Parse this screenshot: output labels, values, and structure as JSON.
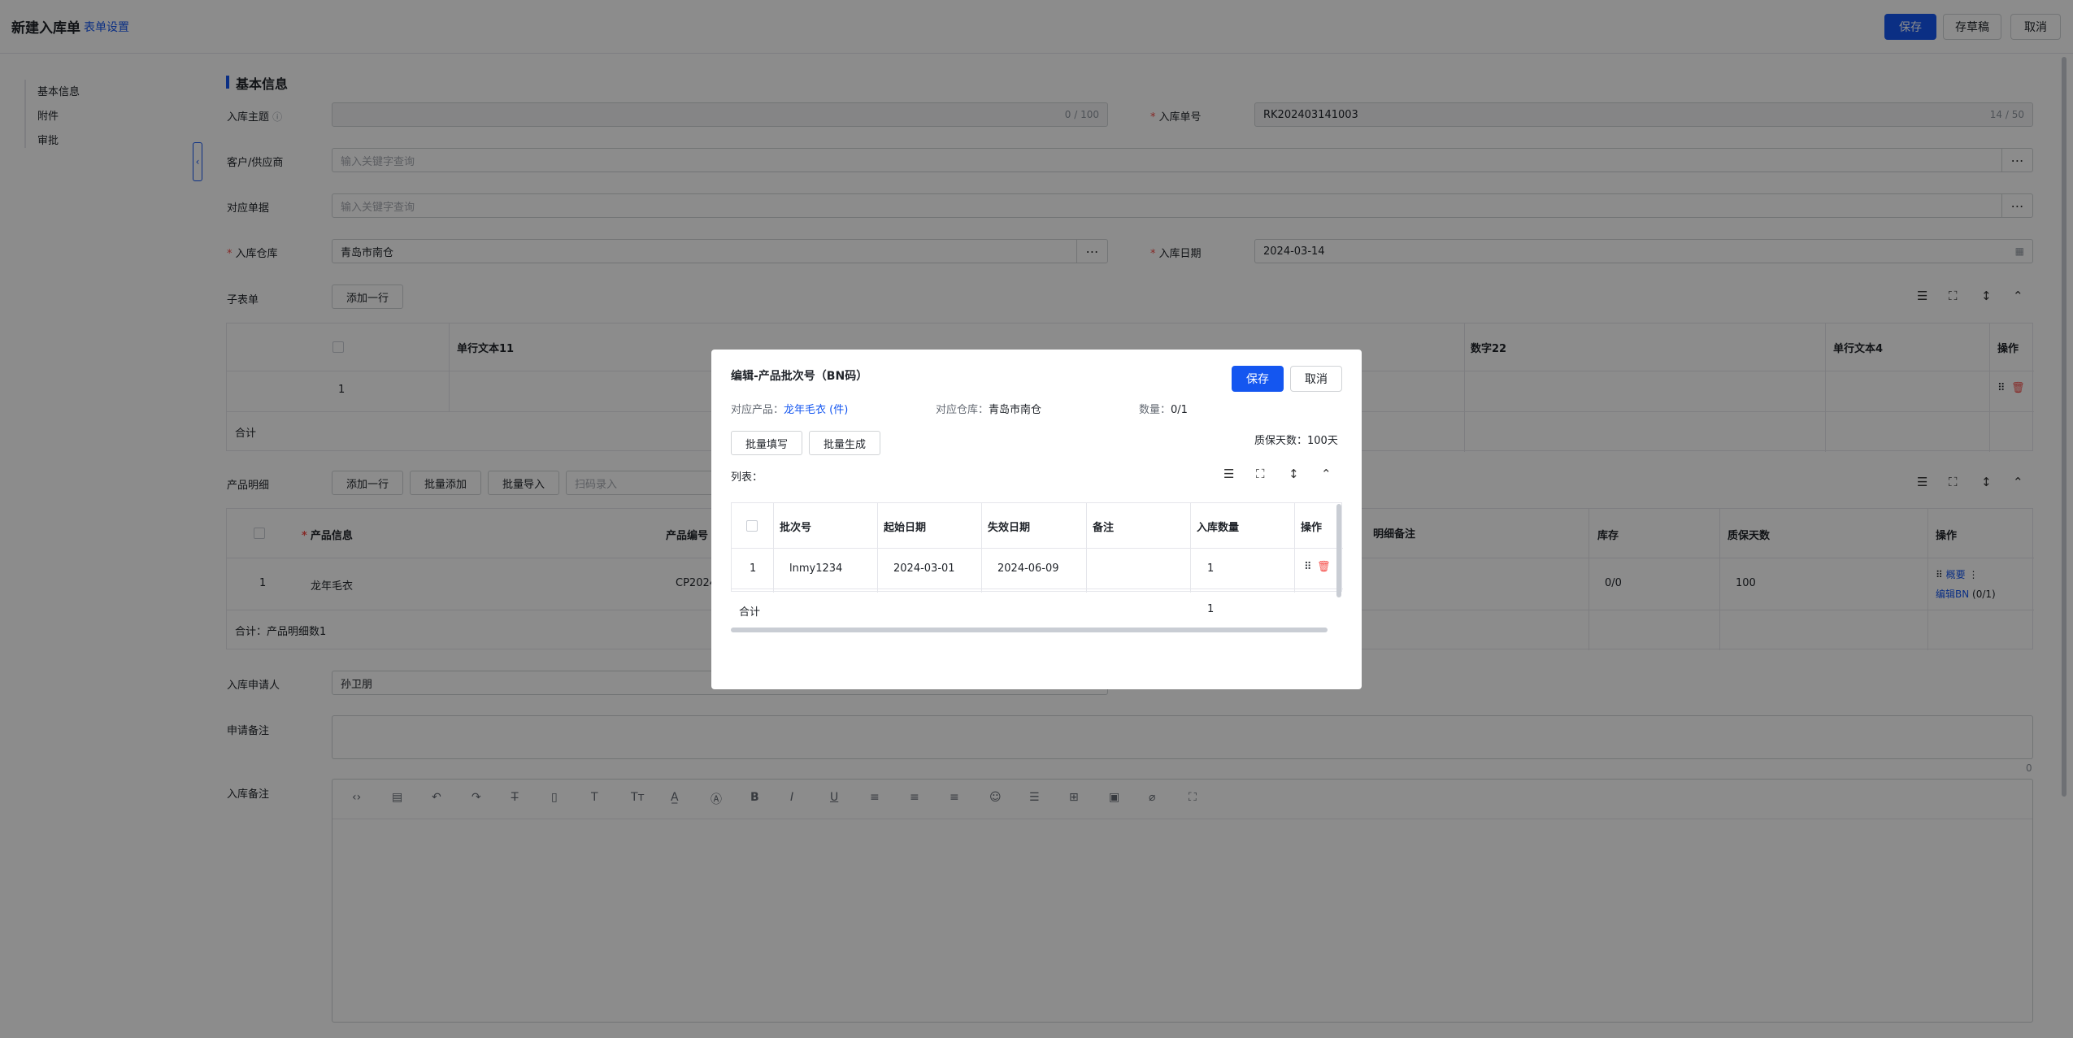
{
  "header": {
    "title": "新建入库单",
    "form_setting": "表单设置",
    "save": "保存",
    "draft": "存草稿",
    "cancel": "取消"
  },
  "left_nav": [
    "基本信息",
    "附件",
    "审批"
  ],
  "section": {
    "title": "基本信息"
  },
  "fields": {
    "subject": {
      "label": "入库主题",
      "counter": "0 / 100"
    },
    "order_no": {
      "label": "入库单号",
      "value": "RK202403141003",
      "counter": "14 / 50"
    },
    "customer": {
      "label": "客户/供应商",
      "placeholder": "输入关键字查询"
    },
    "related": {
      "label": "对应单据",
      "placeholder": "输入关键字查询"
    },
    "warehouse": {
      "label": "入库仓库",
      "value": "青岛市南仓"
    },
    "date": {
      "label": "入库日期",
      "value": "2024-03-14"
    },
    "applicant": {
      "label": "入库申请人",
      "value": "孙卫朋"
    },
    "apply_note": {
      "label": "申请备注",
      "counter": "0"
    },
    "stock_note": {
      "label": "入库备注"
    }
  },
  "sub_table": {
    "label": "子表单",
    "add_row": "添加一行",
    "columns": [
      "单行文本11",
      "数字22",
      "单行文本4",
      "操作"
    ],
    "row_index": "1",
    "total": "合计"
  },
  "product_table": {
    "label": "产品明细",
    "add_row": "添加一行",
    "batch_add": "批量添加",
    "batch_import": "批量导入",
    "scan_placeholder": "扫码录入",
    "columns": [
      "产品信息",
      "产品编号",
      "明细备注",
      "库存",
      "质保天数",
      "操作"
    ],
    "row": {
      "index": "1",
      "name": "龙年毛衣",
      "code": "CP2024",
      "stock": "0/0",
      "warranty": "100",
      "op_more": "概要",
      "op_edit": "编辑BN",
      "op_count": "(0/1)"
    },
    "total": "合计：产品明细数1"
  },
  "modal": {
    "title": "编辑-产品批次号（BN码）",
    "save": "保存",
    "cancel": "取消",
    "product_label": "对应产品：",
    "product_value": "龙年毛衣 (件)",
    "warehouse_label": "对应仓库：",
    "warehouse_value": "青岛市南仓",
    "qty_label": "数量：",
    "qty_value": "0/1",
    "batch_fill": "批量填写",
    "batch_gen": "批量生成",
    "warranty": "质保天数：100天",
    "list_label": "列表：",
    "columns": [
      "批次号",
      "起始日期",
      "失效日期",
      "备注",
      "入库数量",
      "操作"
    ],
    "row": {
      "index": "1",
      "batch": "lnmy1234",
      "start": "2024-03-01",
      "end": "2024-06-09",
      "note": "",
      "qty": "1"
    },
    "total": {
      "label": "合计",
      "qty": "1"
    }
  }
}
